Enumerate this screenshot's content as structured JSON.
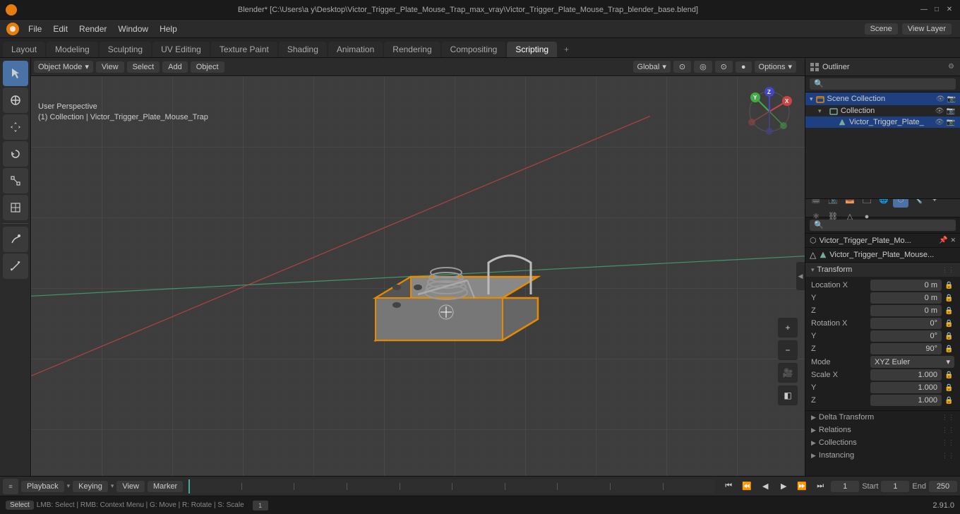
{
  "titlebar": {
    "title": "Blender* [C:\\Users\\a y\\Desktop\\Victor_Trigger_Plate_Mouse_Trap_max_vray\\Victor_Trigger_Plate_Mouse_Trap_blender_base.blend]",
    "minimize": "—",
    "maximize": "□",
    "close": "✕"
  },
  "menubar": {
    "items": [
      "Blender",
      "File",
      "Edit",
      "Render",
      "Window",
      "Help"
    ]
  },
  "workspace_tabs": {
    "tabs": [
      "Layout",
      "Modeling",
      "Sculpting",
      "UV Editing",
      "Texture Paint",
      "Shading",
      "Animation",
      "Rendering",
      "Compositing",
      "Scripting"
    ],
    "active": "Layout",
    "scene_label": "Scene",
    "view_layer_label": "View Layer"
  },
  "viewport": {
    "header": {
      "mode": "Object Mode",
      "view": "View",
      "select": "Select",
      "add": "Add",
      "object": "Object",
      "transform": "Global",
      "options": "Options"
    },
    "info": {
      "perspective": "User Perspective",
      "collection": "(1) Collection | Victor_Trigger_Plate_Mouse_Trap"
    }
  },
  "left_toolbar": {
    "tools": [
      "cursor",
      "move",
      "rotate",
      "scale",
      "transform",
      "annotate",
      "measure"
    ]
  },
  "outliner": {
    "header_label": "Scene Collection",
    "items": [
      {
        "label": "Collection",
        "type": "collection",
        "level": 0,
        "expanded": true
      },
      {
        "label": "Victor_Trigger_Plate_",
        "type": "mesh",
        "level": 1,
        "selected": true
      }
    ]
  },
  "properties": {
    "search_placeholder": "🔍",
    "object_name": "Victor_Trigger_Plate_Mo...",
    "data_name": "Victor_Trigger_Plate_Mouse...",
    "sections": {
      "transform": {
        "label": "Transform",
        "location": {
          "x": "0 m",
          "y": "0 m",
          "z": "0 m"
        },
        "rotation": {
          "x": "0°",
          "y": "0°",
          "z": "90°"
        },
        "mode": "XYZ Euler",
        "scale": {
          "x": "1.000",
          "y": "1.000",
          "z": "1.000"
        }
      },
      "delta_transform": {
        "label": "Delta Transform"
      },
      "relations": {
        "label": "Relations"
      },
      "collections": {
        "label": "Collections"
      },
      "instancing": {
        "label": "Instancing"
      }
    }
  },
  "timeline": {
    "playback": "Playback",
    "keying": "Keying",
    "view": "View",
    "marker": "Marker",
    "frame_current": "1",
    "start": "1",
    "end": "250",
    "start_label": "Start",
    "end_label": "End"
  },
  "statusbar": {
    "select": "Select",
    "version": "2.91.0"
  }
}
